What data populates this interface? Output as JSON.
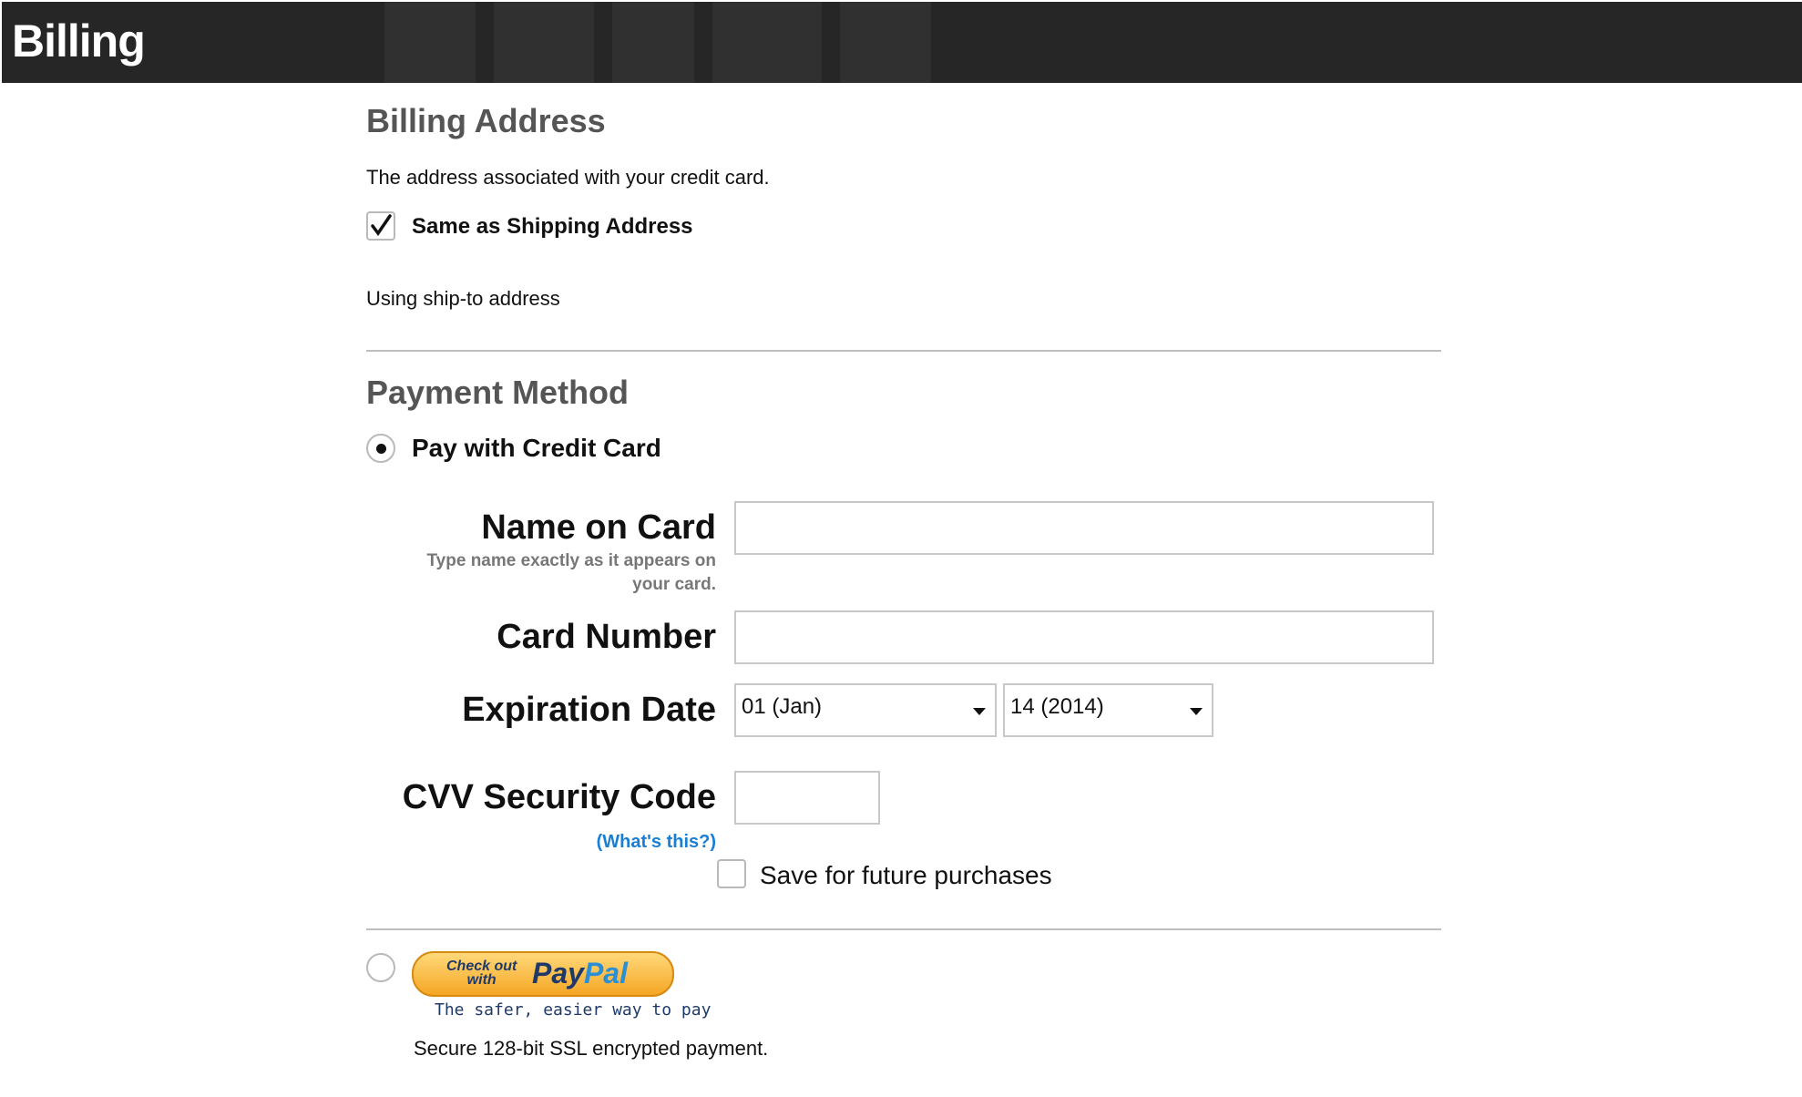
{
  "header": {
    "title": "Billing"
  },
  "billing_address": {
    "heading": "Billing Address",
    "description": "The address associated with your credit card.",
    "same_as_shipping_label": "Same as Shipping Address",
    "same_as_shipping_checked": true,
    "status_text": "Using ship-to address"
  },
  "payment_method": {
    "heading": "Payment Method",
    "credit_card_option_label": "Pay with Credit Card",
    "credit_card_selected": true,
    "fields": {
      "name_on_card_label": "Name on Card",
      "name_on_card_hint": "Type name exactly as it appears on your card.",
      "name_on_card_value": "",
      "card_number_label": "Card Number",
      "card_number_value": "",
      "expiration_label": "Expiration Date",
      "expiration_month": "01 (Jan)",
      "expiration_year": "14 (2014)",
      "cvv_label": "CVV Security Code",
      "cvv_help_link": "(What's this?)",
      "cvv_value": ""
    },
    "save_for_future_label": "Save for future purchases",
    "save_for_future_checked": false
  },
  "paypal": {
    "selected": false,
    "button_small_text_top": "Check out",
    "button_small_text_bottom": "with",
    "logo_pay": "Pay",
    "logo_pal": "Pal",
    "tagline": "The safer, easier way to pay",
    "secure_note": "Secure 128-bit SSL encrypted payment."
  },
  "colors": {
    "header_bg": "#262626",
    "heading_gray": "#555555",
    "link_blue": "#1a7fd4",
    "paypal_navy": "#1f3a68",
    "paypal_blue": "#2b8fd6",
    "paypal_gold": "#f5a624"
  },
  "icons": [
    "checkmark-icon",
    "radio-dot-icon",
    "dropdown-arrow-icon",
    "paypal-logo"
  ]
}
